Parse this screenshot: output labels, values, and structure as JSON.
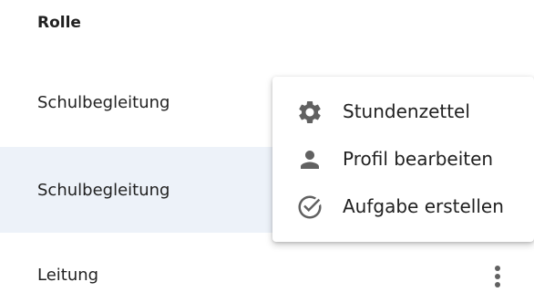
{
  "table": {
    "column_header": "Rolle",
    "rows": [
      {
        "role": "Schulbegleitung",
        "highlighted": false
      },
      {
        "role": "Schulbegleitung",
        "highlighted": true
      },
      {
        "role": "Leitung",
        "highlighted": false
      }
    ],
    "row_action_icon": "more-vert-icon"
  },
  "context_menu": {
    "items": [
      {
        "label": "Stundenzettel",
        "icon": "gear-icon"
      },
      {
        "label": "Profil bearbeiten",
        "icon": "person-icon"
      },
      {
        "label": "Aufgabe erstellen",
        "icon": "check-circle-icon"
      }
    ]
  },
  "colors": {
    "highlight_row": "#edf2f9",
    "icon": "#616161",
    "text": "#212121"
  }
}
